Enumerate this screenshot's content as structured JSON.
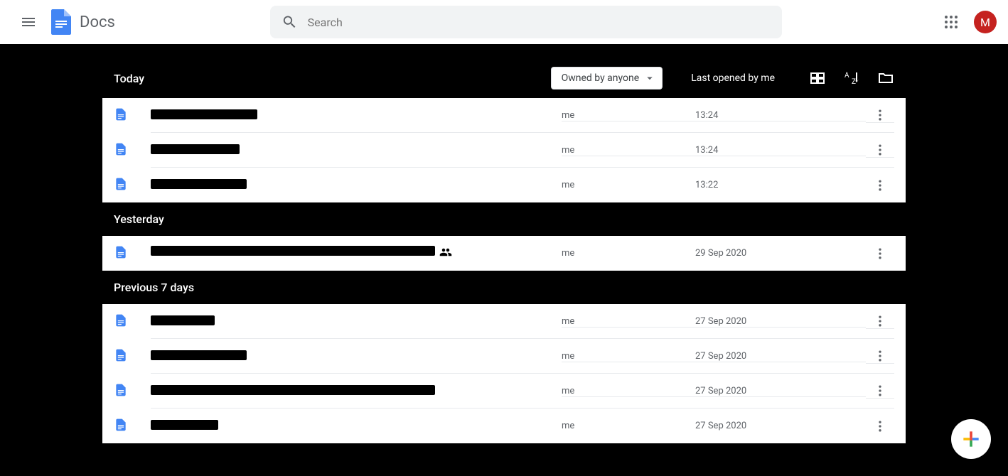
{
  "header": {
    "app_name": "Docs",
    "search_placeholder": "Search",
    "avatar_letter": "M"
  },
  "toolbar": {
    "today_label": "Today",
    "owner_filter": "Owned by anyone",
    "sort_label": "Last opened by me"
  },
  "sections": {
    "today": {
      "items": [
        {
          "title": "[redacted]",
          "redact_width": 150,
          "owner": "me",
          "date": "13:24"
        },
        {
          "title": "[redacted]",
          "redact_width": 125,
          "owner": "me",
          "date": "13:24"
        },
        {
          "title": "[redacted]",
          "redact_width": 135,
          "owner": "me",
          "date": "13:22"
        }
      ]
    },
    "yesterday": {
      "label": "Yesterday",
      "items": [
        {
          "title": "[redacted]",
          "redact_width": 400,
          "owner": "me",
          "date": "29 Sep 2020",
          "shared": true
        }
      ]
    },
    "previous7": {
      "label": "Previous 7 days",
      "items": [
        {
          "title": "[redacted]",
          "redact_width": 90,
          "owner": "me",
          "date": "27 Sep 2020"
        },
        {
          "title": "[redacted]",
          "redact_width": 135,
          "owner": "me",
          "date": "27 Sep 2020"
        },
        {
          "title": "[redacted]",
          "redact_width": 400,
          "owner": "me",
          "date": "27 Sep 2020"
        },
        {
          "title": "[redacted]",
          "redact_width": 95,
          "owner": "me",
          "date": "27 Sep 2020"
        }
      ]
    }
  }
}
